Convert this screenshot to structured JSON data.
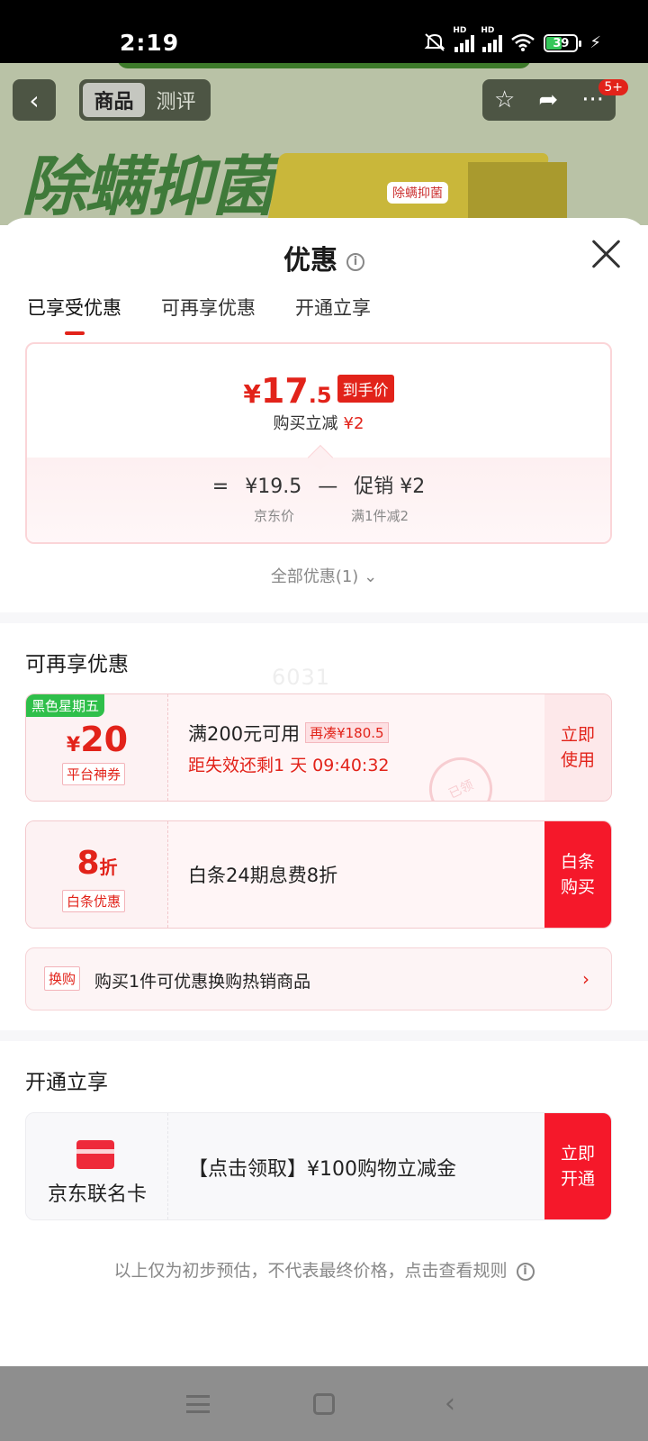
{
  "status": {
    "time": "2:19",
    "battery": "39",
    "hd1": "HD",
    "hd2": "HD"
  },
  "background": {
    "tabs": [
      "商品",
      "测评"
    ],
    "banner_text": "除螨抑菌",
    "box_label": "除螨抑菌",
    "badge": "5+"
  },
  "sheet": {
    "title": "优惠",
    "tabs": [
      {
        "label": "已享受优惠",
        "active": true
      },
      {
        "label": "可再享优惠",
        "active": false
      },
      {
        "label": "开通立享",
        "active": false
      }
    ],
    "price": {
      "currency": "¥",
      "integer": "17",
      "decimal": ".5",
      "final_tag": "到手价",
      "reduce_label": "购买立减",
      "reduce_value": "¥2",
      "eq": "=",
      "jd_price": "¥19.5",
      "minus": "—",
      "promo_label": "促销",
      "promo_value": "¥2",
      "jd_price_caption": "京东价",
      "promo_caption": "满1件减2"
    },
    "all_offers": "全部优惠(1)",
    "section_more": "可再享优惠",
    "watermark": "6031",
    "coupon1": {
      "badge": "黑色星期五",
      "currency": "¥",
      "amount": "20",
      "type": "平台神券",
      "condition": "满200元可用",
      "extra": "再凑¥180.5",
      "expire": "距失效还剩1 天 09:40:32",
      "action": [
        "立即",
        "使用"
      ],
      "stamp": "已领"
    },
    "coupon2": {
      "amount": "8",
      "unit": "折",
      "type": "白条优惠",
      "desc": "白条24期息费8折",
      "action": [
        "白条",
        "购买"
      ]
    },
    "exchange": {
      "tag": "换购",
      "text": "购买1件可优惠换购热销商品"
    },
    "section_open": "开通立享",
    "card": {
      "name": "京东联名卡",
      "desc": "【点击领取】¥100购物立减金",
      "action": [
        "立即",
        "开通"
      ]
    },
    "footer": "以上仅为初步预估，不代表最终价格，点击查看规则"
  },
  "colors": {
    "accent": "#e2231a",
    "green": "#2fbf4a"
  }
}
